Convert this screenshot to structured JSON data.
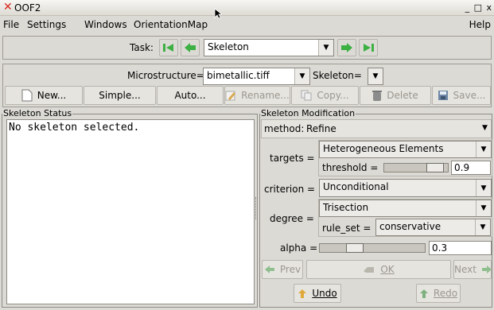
{
  "window": {
    "title": "OOF2",
    "controls": "_ □ x"
  },
  "menu": [
    "File",
    "Settings",
    "Windows",
    "OrientationMap"
  ],
  "menu_help": "Help",
  "task": {
    "label": "Task:",
    "value": "Skeleton"
  },
  "microstructure": {
    "label": "Microstructure=",
    "value": "bimetallic.tiff",
    "skeleton_label": "Skeleton="
  },
  "buttons": {
    "new": "New...",
    "simple": "Simple...",
    "auto": "Auto...",
    "rename": "Rename...",
    "copy": "Copy...",
    "delete": "Delete",
    "save": "Save..."
  },
  "status": {
    "frame_label": "Skeleton Status",
    "text": "No skeleton selected."
  },
  "modification": {
    "frame_label": "Skeleton Modification",
    "method_label": "method:",
    "method_value": "Refine",
    "targets_label": "targets =",
    "targets_value": "Heterogeneous Elements",
    "threshold_label": "threshold =",
    "threshold_value": "0.9",
    "threshold_level": 0.9,
    "criterion_label": "criterion =",
    "criterion_value": "Unconditional",
    "degree_label": "degree =",
    "degree_value": "Trisection",
    "rule_set_label": "rule_set =",
    "rule_set_value": "conservative",
    "alpha_label": "alpha =",
    "alpha_value": "0.3",
    "alpha_level": 0.3
  },
  "bottom": {
    "prev": "Prev",
    "ok": "OK",
    "next": "Next",
    "undo": "Undo",
    "redo": "Redo"
  },
  "colors": {
    "nav_green": "#3cb043",
    "title_x": "#d8281e",
    "background": "#dcdad5"
  }
}
